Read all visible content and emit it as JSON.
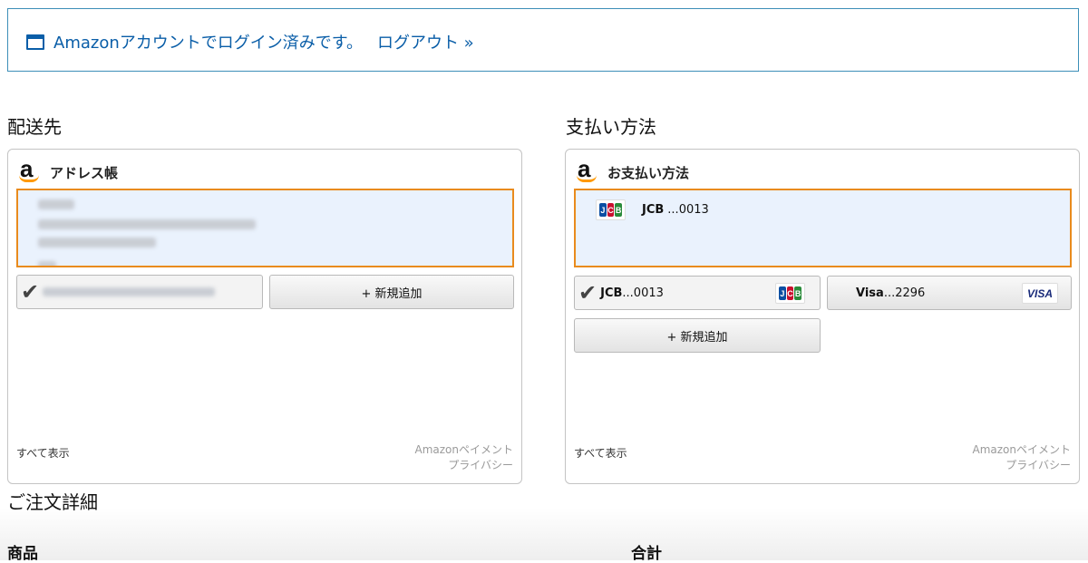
{
  "banner": {
    "message": "Amazonアカウントでログイン済みです。",
    "logout_label": "ログアウト »"
  },
  "shipping": {
    "heading": "配送先",
    "widget_title": "アドレス帳",
    "add_new_label": "+ 新規追加",
    "show_all_label": "すべて表示",
    "privacy_line1": "Amazonペイメント",
    "privacy_line2": "プライバシー"
  },
  "payment": {
    "heading": "支払い方法",
    "widget_title": "お支払い方法",
    "selected_card": {
      "brand": "JCB",
      "number": "...0013"
    },
    "cards": [
      {
        "brand": "JCB",
        "number": "...0013",
        "logo": "jcb-logo",
        "selected": true
      },
      {
        "brand": "Visa",
        "number": "...2296",
        "logo": "visa-logo",
        "selected": false
      }
    ],
    "add_new_label": "+ 新規追加",
    "show_all_label": "すべて表示",
    "privacy_line1": "Amazonペイメント",
    "privacy_line2": "プライバシー"
  },
  "order": {
    "heading": "ご注文詳細",
    "col_product": "商品",
    "col_total": "合計"
  },
  "colors": {
    "link": "#0a5ea8",
    "selected_border": "#e98b1d",
    "selected_bg": "#eaf2fd",
    "amazon_orange": "#ff9900"
  }
}
